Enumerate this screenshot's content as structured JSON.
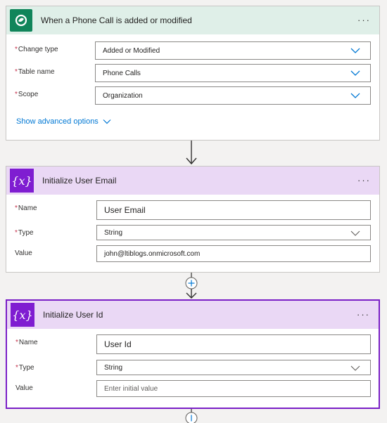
{
  "cards": [
    {
      "title": "When a Phone Call is added or modified",
      "icon": "dataverse-icon",
      "more": "···",
      "fields": [
        {
          "label": "Change type",
          "required": "*",
          "value": "Added or Modified"
        },
        {
          "label": "Table name",
          "required": "*",
          "value": "Phone Calls"
        },
        {
          "label": "Scope",
          "required": "*",
          "value": "Organization"
        }
      ],
      "show_advanced": "Show advanced options"
    },
    {
      "title": "Initialize User Email",
      "icon": "variable-icon",
      "icon_glyph": "{x}",
      "more": "···",
      "fields": [
        {
          "label": "Name",
          "required": "*",
          "value": "User Email"
        },
        {
          "label": "Type",
          "required": "*",
          "value": "String"
        },
        {
          "label": "Value",
          "required": "",
          "value": "john@ltiblogs.onmicrosoft.com"
        }
      ]
    },
    {
      "title": "Initialize User Id",
      "icon": "variable-icon",
      "icon_glyph": "{x}",
      "more": "···",
      "fields": [
        {
          "label": "Name",
          "required": "*",
          "value": "User Id"
        },
        {
          "label": "Type",
          "required": "*",
          "value": "String"
        },
        {
          "label": "Value",
          "required": "",
          "placeholder": "Enter initial value"
        }
      ]
    }
  ],
  "colors": {
    "trigger_header": "#dfefe8",
    "trigger_icon": "#10855a",
    "variable_header": "#ead8f5",
    "variable_icon": "#7f1dd1",
    "selected_border": "#7a1fc6",
    "link": "#0078d4",
    "required": "#c4314b"
  }
}
